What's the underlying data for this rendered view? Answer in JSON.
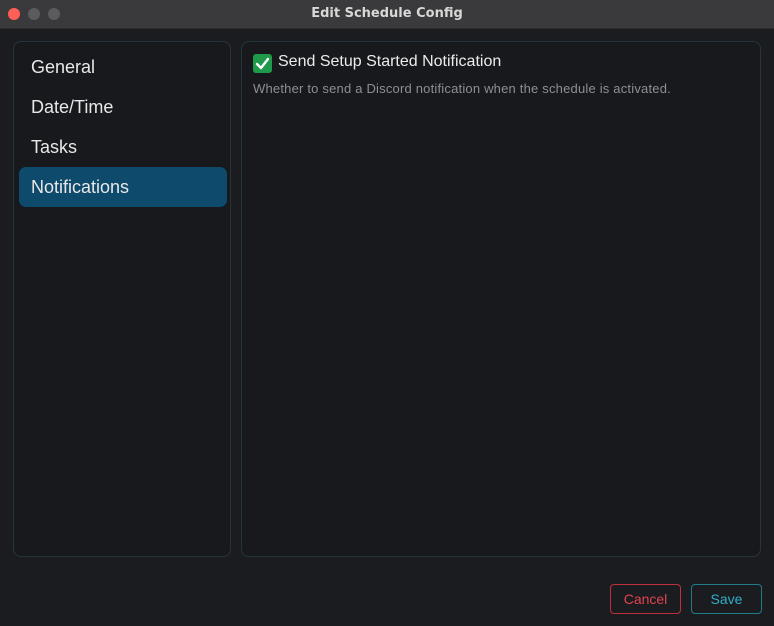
{
  "window": {
    "title": "Edit Schedule Config"
  },
  "sidebar": {
    "items": [
      {
        "label": "General",
        "active": false
      },
      {
        "label": "Date/Time",
        "active": false
      },
      {
        "label": "Tasks",
        "active": false
      },
      {
        "label": "Notifications",
        "active": true
      }
    ]
  },
  "content": {
    "setting": {
      "label": "Send Setup Started Notification",
      "description": "Whether to send a Discord notification when the schedule is activated.",
      "checked": true
    }
  },
  "footer": {
    "cancel_label": "Cancel",
    "save_label": "Save"
  },
  "colors": {
    "accent": "#0e4a6b",
    "check": "#1f9a4a",
    "cancel": "#e0434f",
    "save": "#2fb0c9"
  }
}
